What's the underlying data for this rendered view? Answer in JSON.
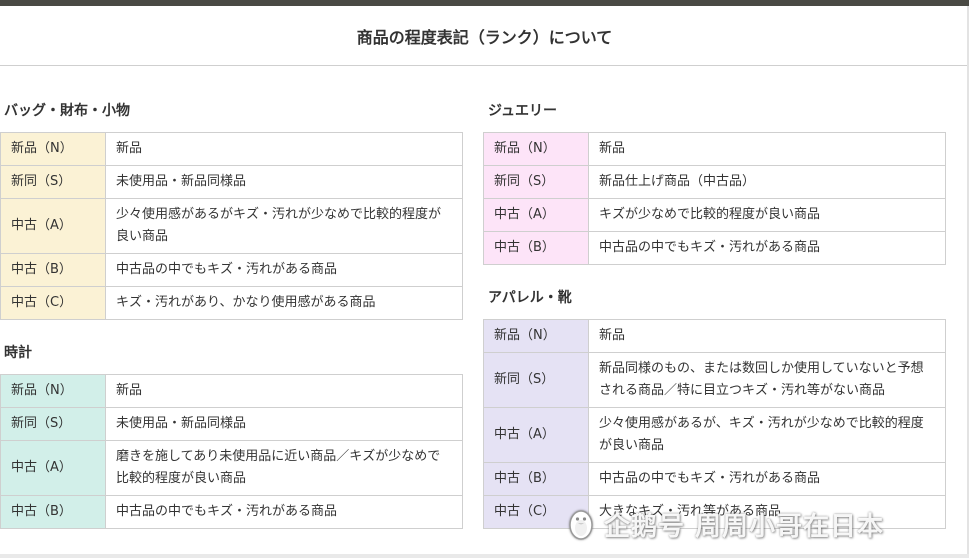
{
  "page": {
    "title": "商品の程度表記（ランク）について"
  },
  "sections": {
    "bag": {
      "title": "バッグ・財布・小物",
      "rows": [
        {
          "rank": "新品（N）",
          "desc": "新品"
        },
        {
          "rank": "新同（S）",
          "desc": "未使用品・新品同様品"
        },
        {
          "rank": "中古（A）",
          "desc": "少々使用感があるがキズ・汚れが少なめで比較的程度が良い商品"
        },
        {
          "rank": "中古（B）",
          "desc": "中古品の中でもキズ・汚れがある商品"
        },
        {
          "rank": "中古（C）",
          "desc": "キズ・汚れがあり、かなり使用感がある商品"
        }
      ]
    },
    "watch": {
      "title": "時計",
      "rows": [
        {
          "rank": "新品（N）",
          "desc": "新品"
        },
        {
          "rank": "新同（S）",
          "desc": "未使用品・新品同様品"
        },
        {
          "rank": "中古（A）",
          "desc": "磨きを施してあり未使用品に近い商品／キズが少なめで比較的程度が良い商品"
        },
        {
          "rank": "中古（B）",
          "desc": "中古品の中でもキズ・汚れがある商品"
        }
      ]
    },
    "jewelry": {
      "title": "ジュエリー",
      "rows": [
        {
          "rank": "新品（N）",
          "desc": "新品"
        },
        {
          "rank": "新同（S）",
          "desc": "新品仕上げ商品（中古品）"
        },
        {
          "rank": "中古（A）",
          "desc": "キズが少なめで比較的程度が良い商品"
        },
        {
          "rank": "中古（B）",
          "desc": "中古品の中でもキズ・汚れがある商品"
        }
      ]
    },
    "apparel": {
      "title": "アパレル・靴",
      "rows": [
        {
          "rank": "新品（N）",
          "desc": "新品"
        },
        {
          "rank": "新同（S）",
          "desc": "新品同様のもの、または数回しか使用していないと予想される商品／特に目立つキズ・汚れ等がない商品"
        },
        {
          "rank": "中古（A）",
          "desc": "少々使用感があるが、キズ・汚れが少なめで比較的程度が良い商品"
        },
        {
          "rank": "中古（B）",
          "desc": "中古品の中でもキズ・汚れがある商品"
        },
        {
          "rank": "中古（C）",
          "desc": "大きなキズ・汚れ等がある商品"
        }
      ]
    }
  },
  "watermark": {
    "text": "企鹅号 周周小哥在日本",
    "icon": "penguin-logo-icon"
  }
}
